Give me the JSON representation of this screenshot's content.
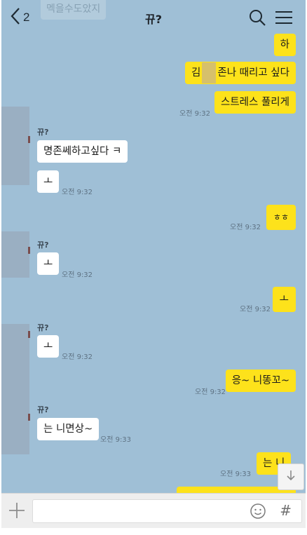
{
  "header": {
    "back_count": "2",
    "title": "뀨?",
    "ghost_preview": "멕을수도았지"
  },
  "messages": {
    "m1": {
      "text": "하"
    },
    "m2": {
      "text_before": "김",
      "text_after": "존나 때리고 싶다"
    },
    "m3": {
      "text": "스트레스 풀리게",
      "time": "오전 9:32"
    },
    "r1": {
      "sender": "뀨?",
      "text": "명존쎄하고싶다 ㅋ"
    },
    "r2": {
      "text": "ㅗ",
      "time": "오전 9:32"
    },
    "m4": {
      "text": "ㅎㅎ",
      "time": "오전 9:32"
    },
    "r3": {
      "sender": "뀨?",
      "text": "ㅗ",
      "time": "오전 9:32"
    },
    "m5": {
      "text": "ㅗ",
      "time": "오전 9:32"
    },
    "r4": {
      "sender": "뀨?",
      "text": "ㅗ",
      "time": "오전 9:32"
    },
    "m6": {
      "text": "응~ 니똥꼬~",
      "time": "오전 9:32"
    },
    "r5": {
      "sender": "뀨?",
      "text": "는 니면상~",
      "time": "오전 9:33"
    },
    "m7": {
      "text": "는 니",
      "time": "오전 9:33"
    }
  },
  "input": {
    "value": "",
    "hash_symbol": "#"
  },
  "colors": {
    "background": "#9fbfd6",
    "my_bubble": "#fde21b",
    "their_bubble": "#ffffff"
  }
}
